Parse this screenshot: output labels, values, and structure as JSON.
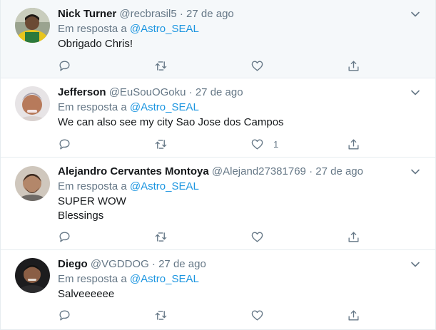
{
  "tweets": [
    {
      "name": "Nick Turner",
      "handle": "@recbrasil5",
      "dot": "·",
      "time": "27 de ago",
      "reply_prefix": "Em resposta a",
      "reply_to": "@Astro_SEAL",
      "lines": [
        "Obrigado Chris!"
      ],
      "like_count": "",
      "highlighted": true
    },
    {
      "name": "Jefferson",
      "handle": "@EuSouOGoku",
      "dot": "·",
      "time": "27 de ago",
      "reply_prefix": "Em resposta a",
      "reply_to": "@Astro_SEAL",
      "lines": [
        "We can also see my city Sao Jose dos Campos"
      ],
      "like_count": "1",
      "highlighted": false
    },
    {
      "name": "Alejandro Cervantes Montoya",
      "handle": "@Alejand27381769",
      "dot": "·",
      "time": "27 de ago",
      "reply_prefix": "Em resposta a",
      "reply_to": "@Astro_SEAL",
      "lines": [
        "SUPER WOW",
        "Blessings"
      ],
      "like_count": "",
      "highlighted": false
    },
    {
      "name": "Diego",
      "handle": "@VGDDOG",
      "dot": "·",
      "time": "27 de ago",
      "reply_prefix": "Em resposta a",
      "reply_to": "@Astro_SEAL",
      "lines": [
        "Salveeeeee"
      ],
      "like_count": "",
      "highlighted": false
    }
  ],
  "icons": {
    "reply": "reply-icon",
    "retweet": "retweet-icon",
    "like": "like-icon",
    "share": "share-icon",
    "menu": "chevron-down-icon"
  },
  "colors": {
    "mention": "#1b95e0",
    "muted": "#657786",
    "text": "#14171a",
    "highlight_bg": "#f5f8fa"
  }
}
